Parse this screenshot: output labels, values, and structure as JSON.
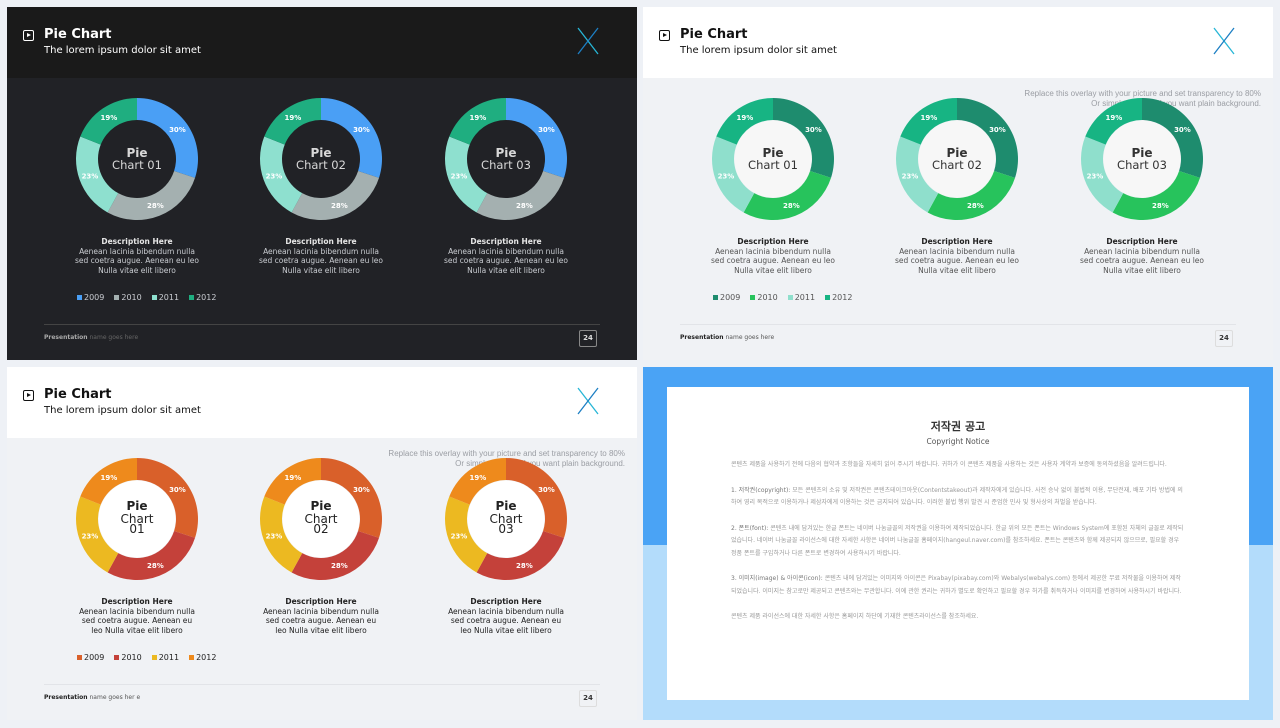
{
  "slides": [
    {
      "theme": "dark",
      "title": "Pie Chart",
      "subtitle": "The lorem ipsum dolor sit amet",
      "overlay": null,
      "colors": {
        "header": "#1a1a1a",
        "body": "#212226",
        "title": "#ffffff",
        "text": "#c9ccd1",
        "desc_title": "#e6e6e6",
        "hole": "#212226",
        "center_text": "#d8d8d8"
      },
      "series_colors": [
        "#4a9ff5",
        "#a4b0b0",
        "#8ee0cf",
        "#1fae80"
      ],
      "charts": [
        {
          "center_top": "Pie",
          "center_bottom": "Chart 01"
        },
        {
          "center_top": "Pie",
          "center_bottom": "Chart 02"
        },
        {
          "center_top": "Pie",
          "center_bottom": "Chart 03"
        }
      ],
      "desc": {
        "title": "Description Here",
        "lines": [
          "Aenean lacinia bibendum nulla",
          "sed coetra augue. Aenean eu leo",
          "Nulla vitae elit libero"
        ]
      },
      "footer_bold": "Presentation",
      "footer_text": "name goes here",
      "page": "24"
    },
    {
      "theme": "green",
      "title": "Pie Chart",
      "subtitle": "The lorem ipsum dolor sit amet",
      "overlay": [
        "Replace this overlay with your picture and set transparency to 80%",
        "Or simply delete it if you want plain background."
      ],
      "colors": {
        "header": "#ffffff",
        "body": "#f0f2f5",
        "title": "#111111",
        "text": "#555555",
        "desc_title": "#222222",
        "hole": "#f7f7f7",
        "center_text": "#333333"
      },
      "series_colors": [
        "#1e8c6e",
        "#27c35c",
        "#8fdfcc",
        "#17b483"
      ],
      "charts": [
        {
          "center_top": "Pie",
          "center_bottom": "Chart 01"
        },
        {
          "center_top": "Pie",
          "center_bottom": "Chart 02"
        },
        {
          "center_top": "Pie",
          "center_bottom": "Chart 03"
        }
      ],
      "desc": {
        "title": "Description Here",
        "lines": [
          "Aenean lacinia bibendum nulla",
          "sed coetra augue. Aenean eu leo",
          "Nulla vitae elit libero"
        ]
      },
      "footer_bold": "Presentation",
      "footer_text": "name goes here",
      "page": "24"
    },
    {
      "theme": "orange",
      "title": "Pie Chart",
      "subtitle": "The lorem ipsum dolor sit amet",
      "overlay": [
        "Replace this overlay with your picture and set transparency to 80%",
        "Or simply delete it if you want plain background."
      ],
      "colors": {
        "header": "#ffffff",
        "body": "#f0f2f5",
        "title": "#111111",
        "text": "#222222",
        "desc_title": "#222222",
        "hole": "#ffffff",
        "center_text": "#222222"
      },
      "series_colors": [
        "#d9602a",
        "#c4413a",
        "#ecb921",
        "#ee8a1c"
      ],
      "charts": [
        {
          "center_top": "Pie",
          "center_bottom": "Chart 01"
        },
        {
          "center_top": "Pie",
          "center_bottom": "Chart 02"
        },
        {
          "center_top": "Pie",
          "center_bottom": "Chart 03"
        }
      ],
      "desc": {
        "title": "Description Here",
        "lines": [
          "Aenean lacinia bibendum nulla",
          "sed coetra augue. Aenean eu",
          "leo  Nulla vitae elit libero"
        ]
      },
      "footer_bold": "Presentation",
      "footer_text": "name goes her e",
      "page": "24"
    }
  ],
  "chart_data": {
    "type": "pie",
    "donut": true,
    "categories": [
      "2009",
      "2010",
      "2011",
      "2012"
    ],
    "values": [
      30,
      28,
      23,
      19
    ],
    "labels": [
      "30%",
      "28%",
      "23%",
      "19%"
    ],
    "legend": "bottom-left"
  },
  "notice": {
    "title": "저작권 공고",
    "subtitle": "Copyright Notice",
    "colors": {
      "top": "#4aa3f5",
      "bottom": "#b3dcfb"
    },
    "intro": "콘텐츠 제품을 사용하기 전에 다음의 협약과 조항들을 자세히 읽어 주시기 바랍니다. 귀하가 이 콘텐츠 제품을 사용하는 것은 사용자 계약과 보증에 동의하셨음을 알려드립니다.",
    "items": [
      {
        "head": "1. 저작권(copyright):",
        "body": "모든 콘텐츠의 소유 및 저작권은 콘텐츠테이크아웃(Contentstakeout)과 제작자에게 있습니다. 사전 승낙 없이 불법적 이용, 무단전재, 배포 기타 방법에 의하여 영리 목적으로 이용하거나 제삼자에게 이용하는 것은 금지되어 있습니다. 이러한 불법 행위 발견 시 준엄한 민사 및 형사상의 처벌을 받습니다."
      },
      {
        "head": "2. 폰트(font):",
        "body": "콘텐츠 내에 담겨있는 한글 폰트는 네이버 나눔글꼴의 저작권을 이용하여 제작되었습니다. 한글 위의 모든 폰트는 Windows System에 포함된 자체의 글꼴로 제작되었습니다. 네이버 나눔글꼴 라이선스에 대한 자세한 사항은 네이버 나눔글꼴 홈페이지(hangeul.naver.com)를 참조하세요. 폰트는 콘텐츠와 함께 제공되지 않으므로, 필요할 경우 정품 폰트를 구입하거나 다른 폰트로 변경하여 사용하시기 바랍니다."
      },
      {
        "head": "3. 이미지(image) & 아이콘(icon):",
        "body": "콘텐츠 내에 담겨있는 이미지와 아이콘은 Pixabay(pixabay.com)와 Webalys(webalys.com) 등에서 제공한 무료 저작물을 이용하여 제작되었습니다. 이미지는 참고로만 제공되고 콘텐츠와는 무관합니다. 이에 관한 권리는 귀하가 별도로 확인하고 필요할 경우 허가를 취득하거나 이미지를 변경하여 사용하시기 바랍니다."
      }
    ],
    "outro": "콘텐츠 제품 라이선스에 대한 자세한 사항은 홈페이지 하단에 기재한 콘텐츠라이선스를 참조하세요."
  }
}
